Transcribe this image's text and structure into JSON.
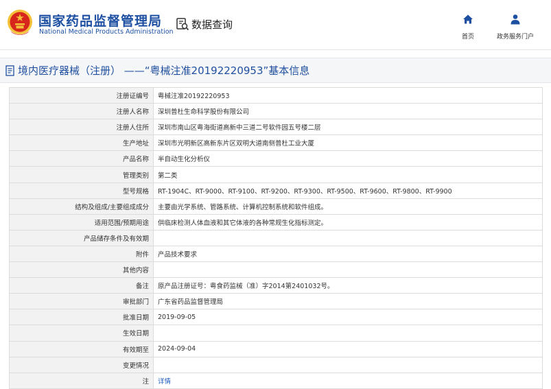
{
  "header": {
    "org_name_cn": "国家药品监督管理局",
    "org_name_en": "National Medical Products Administration",
    "query_title": "数据查询",
    "nav": [
      {
        "label": "首页",
        "icon": "home-icon"
      },
      {
        "label": "政务服务门户",
        "icon": "user-icon"
      }
    ]
  },
  "page": {
    "title": "境内医疗器械（注册） ——“粤械注准20192220953”基本信息",
    "title_icon": "document-icon"
  },
  "record": {
    "rows": [
      {
        "label": "注册证编号",
        "value": "粤械注准20192220953"
      },
      {
        "label": "注册人名称",
        "value": "深圳普杜生命科学股份有限公司"
      },
      {
        "label": "注册人住所",
        "value": "深圳市南山区粤海街道高新中三道二号软件园五号楼二层"
      },
      {
        "label": "生产地址",
        "value": "深圳市光明新区高新东片区双明大道南侧普杜工业大厦"
      },
      {
        "label": "产品名称",
        "value": "半自动生化分析仪"
      },
      {
        "label": "管理类别",
        "value": "第二类"
      },
      {
        "label": "型号规格",
        "value": "RT-1904C、RT-9000、RT-9100、RT-9200、RT-9300、RT-9500、RT-9600、RT-9800、RT-9900"
      },
      {
        "label": "结构及组成/主要组成成分",
        "value": "主要由光学系统、管路系统、计算机控制系统和软件组成。"
      },
      {
        "label": "适用范围/预期用途",
        "value": "供临床检测人体血液和其它体液的各种常规生化指标测定。"
      },
      {
        "label": "产品储存条件及有效期",
        "value": ""
      },
      {
        "label": "附件",
        "value": "产品技术要求"
      },
      {
        "label": "其他内容",
        "value": ""
      },
      {
        "label": "备注",
        "value": "原产品注册证号：粤食药监械（准）字2014第2401032号。"
      },
      {
        "label": "审批部门",
        "value": "广东省药品监督管理局"
      },
      {
        "label": "批准日期",
        "value": "2019-09-05"
      },
      {
        "label": "生效日期",
        "value": ""
      },
      {
        "label": "有效期至",
        "value": "2024-09-04"
      },
      {
        "label": "变更情况",
        "value": ""
      },
      {
        "label": "注",
        "value": "详情",
        "link": true
      }
    ]
  },
  "colors": {
    "brand_blue": "#1e50a2",
    "link_blue": "#1e5bbf",
    "label_bg": "#f2f2f2",
    "emblem_red": "#d7261c",
    "emblem_gold": "#f3c13a"
  }
}
